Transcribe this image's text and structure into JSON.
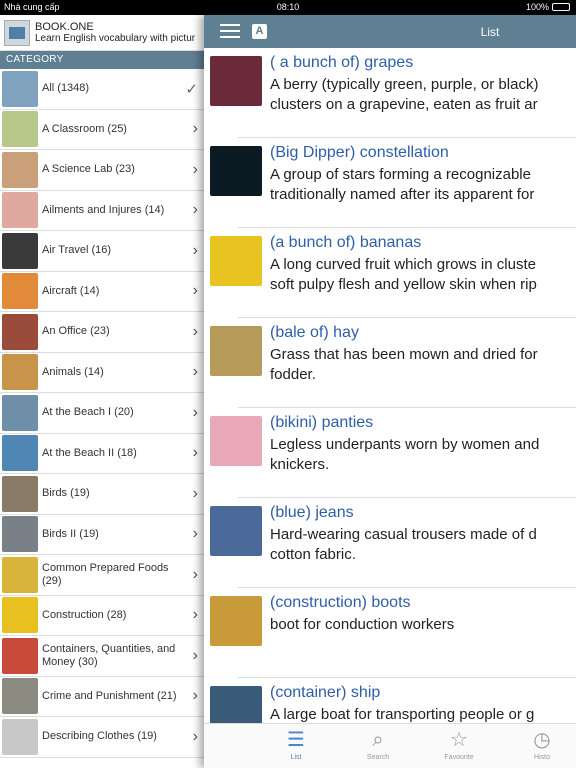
{
  "statusbar": {
    "carrier": "Nhà cung cấp",
    "time": "08:10",
    "battery": "100%"
  },
  "brand": {
    "title": "BOOK.ONE",
    "subtitle": "Learn English vocabulary with pictur"
  },
  "category_header": "CATEGORY",
  "categories": [
    {
      "label": "All (1348)",
      "selected": true,
      "thumb": "#7fa3bf"
    },
    {
      "label": "A Classroom (25)",
      "thumb": "#b7c98a"
    },
    {
      "label": "A Science Lab (23)",
      "thumb": "#c9a07a"
    },
    {
      "label": "Ailments and Injures (14)",
      "thumb": "#e0a9a0"
    },
    {
      "label": "Air Travel (16)",
      "thumb": "#3a3a3a"
    },
    {
      "label": "Aircraft (14)",
      "thumb": "#e08a3a"
    },
    {
      "label": "An Office (23)",
      "thumb": "#9a4a3a"
    },
    {
      "label": "Animals (14)",
      "thumb": "#c8934a"
    },
    {
      "label": "At the Beach I (20)",
      "thumb": "#6f8fa8"
    },
    {
      "label": "At the Beach II (18)",
      "thumb": "#4f86b3"
    },
    {
      "label": "Birds (19)",
      "thumb": "#8a7a68"
    },
    {
      "label": "Birds II (19)",
      "thumb": "#7a8088"
    },
    {
      "label": "Common Prepared Foods (29)",
      "thumb": "#d8b43a"
    },
    {
      "label": "Construction (28)",
      "thumb": "#e8c020"
    },
    {
      "label": "Containers, Quantities, and Money (30)",
      "thumb": "#c84a3a"
    },
    {
      "label": "Crime and Punishment (21)",
      "thumb": "#8a8a80"
    },
    {
      "label": "Describing Clothes (19)",
      "thumb": "#c8c8c8"
    }
  ],
  "topbar": {
    "title": "List",
    "a_badge": "A"
  },
  "entries": [
    {
      "word": "( a bunch of) grapes",
      "definition": "A berry (typically green, purple, or black)\nclusters on a grapevine, eaten as fruit ar",
      "img": "#6a2a3a"
    },
    {
      "word": "(Big Dipper) constellation",
      "definition": "A group of stars forming a recognizable\ntraditionally named after its apparent for",
      "img": "#0c1a24"
    },
    {
      "word": "(a bunch of) bananas",
      "definition": "A long curved fruit which grows in cluste\nsoft pulpy flesh and yellow skin when rip",
      "img": "#e8c420"
    },
    {
      "word": "(bale of) hay",
      "definition": "Grass that has been mown and dried for\nfodder.",
      "img": "#b59a5a"
    },
    {
      "word": "(bikini) panties",
      "definition": "Legless underpants worn by women and\nknickers.",
      "img": "#e8a8b8"
    },
    {
      "word": "(blue) jeans",
      "definition": "Hard-wearing casual trousers made of d\ncotton fabric.",
      "img": "#4a6a9a"
    },
    {
      "word": "(construction) boots",
      "definition": "boot for conduction workers",
      "img": "#c89a3a"
    },
    {
      "word": "(container) ship",
      "definition": "A large boat for transporting people or g",
      "img": "#3a5a7a"
    }
  ],
  "tabs": [
    {
      "label": "List",
      "active": true
    },
    {
      "label": "Search"
    },
    {
      "label": "Favourite"
    },
    {
      "label": "Histo"
    }
  ],
  "colors": {
    "accent": "#5f7f93",
    "link": "#2f5ea8",
    "active_tab": "#4a86c8"
  }
}
